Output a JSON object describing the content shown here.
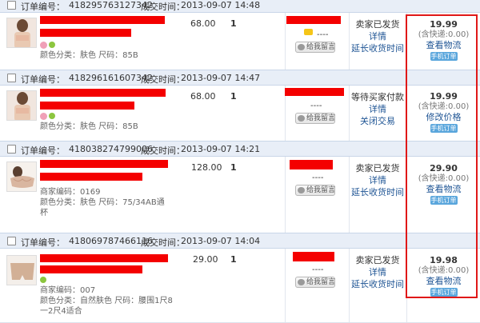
{
  "labels": {
    "order_no": "订单编号：",
    "deal_time": "成交时间：",
    "details": "详情",
    "extend_receipt": "延长收货时间",
    "close_trade": "关闭交易",
    "modify_price": "修改价格",
    "view_logistics": "查看物流",
    "leave_msg": "给我留言",
    "phone_order": "手机订单",
    "dashes": "----"
  },
  "colors": {
    "accent_link": "#1e5494",
    "redaction": "#f40000",
    "highlight_box": "#e01818",
    "header_bg": "#e8eef7"
  },
  "orders": [
    {
      "order_no": "418295763127342",
      "deal_time": "2013-09-07 14:48",
      "price": "68.00",
      "qty": "1",
      "attrs": [
        "颜色分类：肤色    尺码：85B"
      ],
      "status": "卖家已发货",
      "status_links": [
        "详情",
        "延长收货时间"
      ],
      "total": "19.99",
      "shipping": "(含快递:0.00)",
      "pay_link": "查看物流"
    },
    {
      "order_no": "418296161607342",
      "deal_time": "2013-09-07 14:47",
      "price": "68.00",
      "qty": "1",
      "attrs": [
        "颜色分类：肤色    尺码：85B"
      ],
      "status": "等待买家付款",
      "status_links": [
        "详情",
        "关闭交易"
      ],
      "total": "19.99",
      "shipping": "(含快递:0.00)",
      "pay_link": "修改价格"
    },
    {
      "order_no": "418038274799006",
      "deal_time": "2013-09-07 14:21",
      "price": "128.00",
      "qty": "1",
      "attrs": [
        "商家编码：0169",
        "颜色分类：肤色    尺码：75/34AB通",
        "杯"
      ],
      "status": "卖家已发货",
      "status_links": [
        "详情",
        "延长收货时间"
      ],
      "total": "29.90",
      "shipping": "(含快递:0.00)",
      "pay_link": "查看物流"
    },
    {
      "order_no": "418069787466116",
      "deal_time": "2013-09-07 14:04",
      "price": "29.00",
      "qty": "1",
      "attrs": [
        "商家编码：007",
        "颜色分类：自然肤色    尺码：腰围1尺8",
        "一2尺4适合"
      ],
      "status": "卖家已发货",
      "status_links": [
        "详情",
        "延长收货时间"
      ],
      "total": "19.98",
      "shipping": "(含快递:0.00)",
      "pay_link": "查看物流"
    }
  ]
}
